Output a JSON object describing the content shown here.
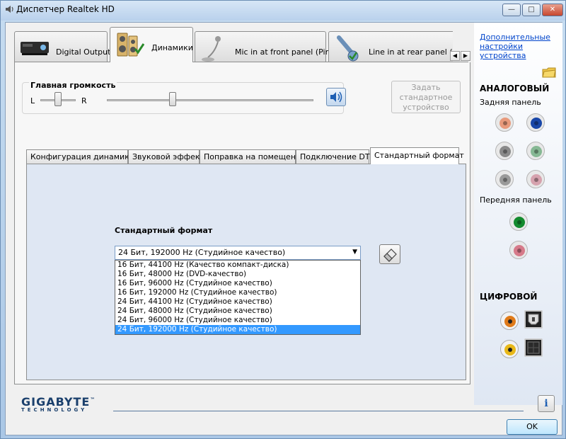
{
  "window": {
    "title": "Диспетчер Realtek HD",
    "controls": [
      "minimize",
      "maximize",
      "close"
    ]
  },
  "device_tabs": [
    {
      "label": "Digital Output",
      "icon": "digital-output-device-icon",
      "active": false
    },
    {
      "label": "Динамики",
      "icon": "speakers-icon",
      "active": true
    },
    {
      "label": "Mic in at front panel (Pink)",
      "icon": "microphone-icon",
      "active": false
    },
    {
      "label": "Line in at rear panel (Blue)",
      "icon": "line-in-icon",
      "active": false
    }
  ],
  "volume": {
    "title": "Главная громкость",
    "left_label": "L",
    "right_label": "R",
    "balance_level": 0.5,
    "volume_level": 0.32
  },
  "set_default_button": "Задать стандартное устройство",
  "inner_tabs": [
    {
      "label": "Конфигурация динамиков",
      "active": false
    },
    {
      "label": "Звуковой эффект",
      "active": false
    },
    {
      "label": "Поправка на помещение",
      "active": false
    },
    {
      "label": "Подключение DTS",
      "active": false
    },
    {
      "label": "Стандартный формат",
      "active": true
    }
  ],
  "format": {
    "label": "Стандартный формат",
    "selected": "24 Бит, 192000 Hz (Студийное качество)",
    "options": [
      "16 Бит, 44100 Hz (Качество компакт-диска)",
      "16 Бит, 48000 Hz (DVD-качество)",
      "16 Бит, 96000 Hz (Студийное качество)",
      "16 Бит, 192000 Hz (Студийное качество)",
      "24 Бит, 44100 Hz (Студийное качество)",
      "24 Бит, 48000 Hz (Студийное качество)",
      "24 Бит, 96000 Hz (Студийное качество)",
      "24 Бит, 192000 Hz (Студийное качество)"
    ],
    "highlighted_index": 7
  },
  "right_panel": {
    "advanced_link": "Дополнительные настройки устройства",
    "analog_title": "АНАЛОГОВЫЙ",
    "rear_panel": "Задняя панель",
    "front_panel": "Передняя панель",
    "digital_title": "ЦИФРОВОЙ",
    "rear_jacks": [
      {
        "name": "rear-jack-orange",
        "color": "#e89a7c"
      },
      {
        "name": "rear-jack-blue",
        "color": "#1846a8"
      },
      {
        "name": "rear-jack-gray-1",
        "color": "#8a8a8a"
      },
      {
        "name": "rear-jack-green",
        "color": "#86b894"
      },
      {
        "name": "rear-jack-gray-2",
        "color": "#9a9a9a"
      },
      {
        "name": "rear-jack-pink",
        "color": "#d6a2ae"
      }
    ],
    "front_jacks": [
      {
        "name": "front-jack-green",
        "color": "#138a2e"
      },
      {
        "name": "front-jack-pink",
        "color": "#d67a8a"
      }
    ]
  },
  "footer": {
    "logo": "GIGABYTE",
    "logo_tm": "™",
    "logo_sub": "TECHNOLOGY",
    "info_label": "i",
    "ok_button": "OK"
  }
}
